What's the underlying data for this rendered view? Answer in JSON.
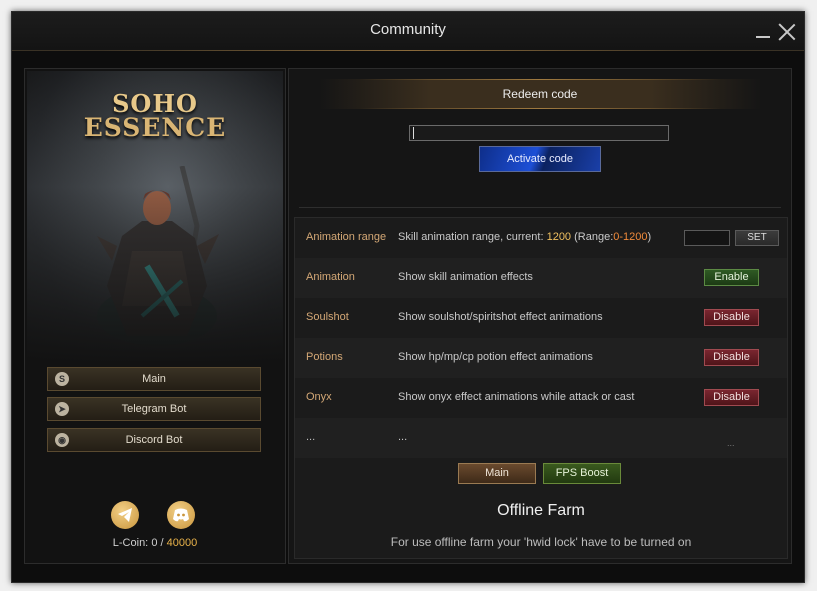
{
  "window": {
    "title": "Community"
  },
  "left": {
    "logo": {
      "line1": "SOHO",
      "line2": "ESSENCE"
    },
    "buttons": [
      {
        "label": "Main",
        "icon": "soho-s-icon"
      },
      {
        "label": "Telegram Bot",
        "icon": "telegram-icon"
      },
      {
        "label": "Discord Bot",
        "icon": "discord-icon"
      }
    ],
    "lcoin": {
      "label": "L-Coin:",
      "current": "0",
      "separator": "/",
      "max": "40000"
    }
  },
  "redeem": {
    "header": "Redeem code",
    "input_value": "",
    "activate_label": "Activate code"
  },
  "settings": {
    "animation_range": {
      "name": "Animation range",
      "desc_prefix": "Skill animation range, current:",
      "current": "1200",
      "range_prefix": "(Range:",
      "range": "0-1200",
      "range_suffix": ")",
      "input_value": "",
      "set_label": "SET"
    },
    "rows": [
      {
        "name": "Animation",
        "desc": "Show skill animation effects",
        "button": "Enable"
      },
      {
        "name": "Soulshot",
        "desc": "Show soulshot/spiritshot effect animations",
        "button": "Disable"
      },
      {
        "name": "Potions",
        "desc": "Show hp/mp/cp potion effect animations",
        "button": "Disable"
      },
      {
        "name": "Onyx",
        "desc": "Show onyx effect animations while attack or cast",
        "button": "Disable"
      }
    ],
    "placeholder_row": {
      "name": "...",
      "desc": "...",
      "extra": "..."
    },
    "tabs": {
      "main": "Main",
      "fps": "FPS Boost"
    }
  },
  "offline_farm": {
    "title": "Offline Farm",
    "desc": "For use offline farm your 'hwid lock' have to be turned on"
  },
  "colors": {
    "accent_gold": "#e8b24a",
    "enable_green": "#2f5a24",
    "disable_red": "#7a2630",
    "activate_blue": "#1d4fd6"
  }
}
